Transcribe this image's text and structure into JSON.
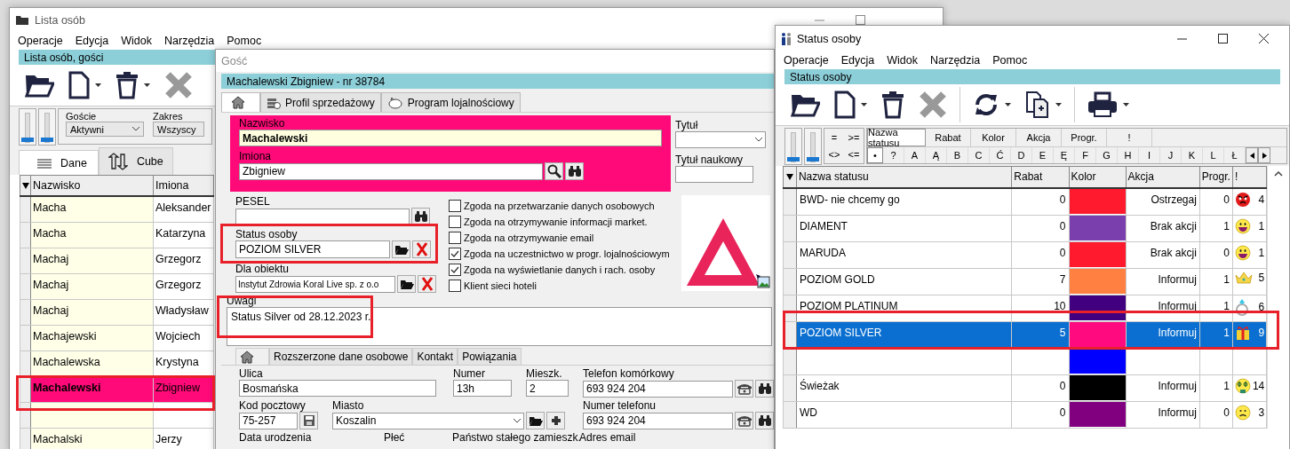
{
  "people_window": {
    "title": "Lista osób",
    "menu": [
      "Operacje",
      "Edycja",
      "Widok",
      "Narzędzia",
      "Pomoc"
    ],
    "panel_title": "Lista osób, gości",
    "sliders": [
      {
        "level": 0
      },
      {
        "level": 0
      }
    ],
    "filters": [
      {
        "label": "Goście",
        "value": "Aktywni"
      },
      {
        "label": "Zakres",
        "value": "Wszyscy"
      }
    ],
    "tabs": [
      {
        "label": "Dane",
        "kind": "list",
        "selected": true
      },
      {
        "label": "Cube",
        "kind": "cube",
        "selected": false
      }
    ],
    "table": {
      "columns": [
        "Nazwisko",
        "Imiona"
      ],
      "rows": [
        {
          "surname": "Macha",
          "first_name": "Aleksander",
          "selected": false
        },
        {
          "surname": "Macha",
          "first_name": "Katarzyna",
          "selected": false
        },
        {
          "surname": "Machaj",
          "first_name": "Grzegorz",
          "selected": false
        },
        {
          "surname": "Machaj",
          "first_name": "Grzegorz",
          "selected": false
        },
        {
          "surname": "Machaj",
          "first_name": "Władysław",
          "selected": false
        },
        {
          "surname": "Machajewski",
          "first_name": "Wojciech",
          "selected": false
        },
        {
          "surname": "Machalewska",
          "first_name": "Krystyna",
          "selected": false
        },
        {
          "surname": "Machalewski",
          "first_name": "Zbigniew",
          "selected": true
        },
        {
          "selected": false
        },
        {
          "surname": "Machalski",
          "first_name": "Jerzy",
          "selected": false
        }
      ]
    }
  },
  "guest_window": {
    "title": "Gość",
    "header": "Machalewski  Zbigniew - nr 38784",
    "tabs": [
      {
        "kind": "home",
        "selected": true
      },
      {
        "kind": "sales",
        "label": "Profil sprzedażowy",
        "selected": false
      },
      {
        "kind": "loyalty",
        "label": "Program lojalnościowy",
        "selected": false
      }
    ],
    "surname": {
      "label": "Nazwisko",
      "value": "Machalewski"
    },
    "first_names": {
      "label": "Imiona",
      "value": "Zbigniew"
    },
    "title_field": {
      "label": "Tytuł"
    },
    "academic_title": {
      "label": "Tytuł naukowy"
    },
    "pesel": {
      "label": "PESEL"
    },
    "status": {
      "label": "Status osoby",
      "value": "POZIOM SILVER"
    },
    "facility": {
      "label": "Dla obiektu",
      "value": "Instytut Zdrowia Koral Live sp. z o.o"
    },
    "consents": [
      {
        "label": "Zgoda na przetwarzanie danych osobowych",
        "checked": false
      },
      {
        "label": "Zgoda na otrzymywanie informacji market.",
        "checked": false
      },
      {
        "label": "Zgoda na otrzymywanie email",
        "checked": false
      },
      {
        "label": "Zgoda na uczestnictwo w progr. lojalnościowym",
        "checked": true
      },
      {
        "label": "Zgoda na wyświetlanie danych i rach. osoby",
        "checked": true
      },
      {
        "label": "Klient sieci hoteli",
        "checked": false
      }
    ],
    "notes": {
      "label": "Uwagi",
      "value": "Status Silver od 28.12.2023 r."
    },
    "lower_tabs": [
      {
        "kind": "home",
        "selected": true
      },
      {
        "kind": "text",
        "label": "Rozszerzone dane osobowe",
        "selected": false
      },
      {
        "kind": "text",
        "label": "Kontakt",
        "selected": false
      },
      {
        "kind": "text",
        "label": "Powiązania",
        "selected": false
      }
    ],
    "street": {
      "label": "Ulica",
      "value": "Bosmańska"
    },
    "number": {
      "label": "Numer",
      "value": "13h"
    },
    "flat": {
      "label": "Mieszk.",
      "value": "2"
    },
    "mobile": {
      "label": "Telefon komórkowy",
      "value": "693 924 204"
    },
    "postcode": {
      "label": "Kod pocztowy",
      "value": "75-257"
    },
    "city": {
      "label": "Miasto",
      "value": "Koszalin"
    },
    "phone": {
      "label": "Numer telefonu",
      "value": "693 924 204"
    },
    "cut_labels": [
      "Data urodzenia",
      "Płeć",
      "Państwo stałego zamieszk.",
      "Adres email"
    ]
  },
  "status_window": {
    "title": "Status osoby",
    "menu": [
      "Operacje",
      "Edycja",
      "Widok",
      "Narzędzia",
      "Pomoc"
    ],
    "panel_title": "Status osoby",
    "sliders": [
      {
        "level": 0
      },
      {
        "level": 0
      }
    ],
    "operators": [
      "=",
      ">=",
      "<>",
      "<="
    ],
    "filter_tabs": [
      {
        "label": "Nazwa statusu",
        "selected": true
      },
      {
        "label": "Rabat",
        "selected": false
      },
      {
        "label": "Kolor",
        "selected": false
      },
      {
        "label": "Akcja",
        "selected": false
      },
      {
        "label": "Progr.",
        "selected": false
      },
      {
        "label": "!",
        "selected": false
      }
    ],
    "letters": [
      {
        "label": "•",
        "selected": true
      },
      {
        "label": "?",
        "selected": false
      },
      {
        "label": "A",
        "selected": false
      },
      {
        "label": "Ą",
        "selected": false
      },
      {
        "label": "B",
        "selected": false
      },
      {
        "label": "C",
        "selected": false
      },
      {
        "label": "Ć",
        "selected": false
      },
      {
        "label": "D",
        "selected": false
      },
      {
        "label": "E",
        "selected": false
      },
      {
        "label": "Ę",
        "selected": false
      },
      {
        "label": "F",
        "selected": false
      },
      {
        "label": "G",
        "selected": false
      },
      {
        "label": "H",
        "selected": false
      },
      {
        "label": "I",
        "selected": false
      },
      {
        "label": "J",
        "selected": false
      },
      {
        "label": "K",
        "selected": false
      },
      {
        "label": "L",
        "selected": false
      },
      {
        "label": "Ł",
        "selected": false
      }
    ],
    "table": {
      "columns": [
        "Nazwa statusu",
        "Rabat",
        "Kolor",
        "Akcja",
        "Progr.",
        "!"
      ],
      "rows": [
        {
          "name": "BWD- nie chcemy go",
          "discount": "0",
          "color": "#ff1a2e",
          "action": "Ostrzegaj",
          "progr": "0",
          "kind": "angry",
          "count": "4",
          "selected": false
        },
        {
          "name": "DIAMENT",
          "discount": "0",
          "color": "#7b3fad",
          "action": "Brak akcji",
          "progr": "1",
          "kind": "grin",
          "count": "1",
          "selected": false
        },
        {
          "name": "MARUDA",
          "discount": "0",
          "color": "#ff1a2e",
          "action": "Brak akcji",
          "progr": "0",
          "kind": "grin",
          "count": "1",
          "selected": false
        },
        {
          "name": "POZIOM GOLD",
          "discount": "7",
          "color": "#ff8040",
          "action": "Informuj",
          "progr": "1",
          "kind": "crown",
          "count": "5",
          "selected": false
        },
        {
          "name": "POZIOM PLATINUM",
          "discount": "10",
          "color": "#400080",
          "action": "Informuj",
          "progr": "1",
          "kind": "ring",
          "count": "6",
          "selected": false
        },
        {
          "name": "POZIOM SILVER",
          "discount": "5",
          "color": "#ff0a7f",
          "action": "Informuj",
          "progr": "1",
          "kind": "gift",
          "count": "9",
          "selected": true
        },
        {
          "color": "#0000ff",
          "selected": false
        },
        {
          "name": "Świeżak",
          "discount": "0",
          "color": "#000000",
          "action": "Informuj",
          "progr": "1",
          "kind": "money",
          "count": "14",
          "selected": false
        },
        {
          "name": "WD",
          "discount": "0",
          "color": "#800080",
          "action": "Informuj",
          "progr": "0",
          "kind": "sad",
          "count": "3",
          "selected": false
        }
      ]
    }
  }
}
